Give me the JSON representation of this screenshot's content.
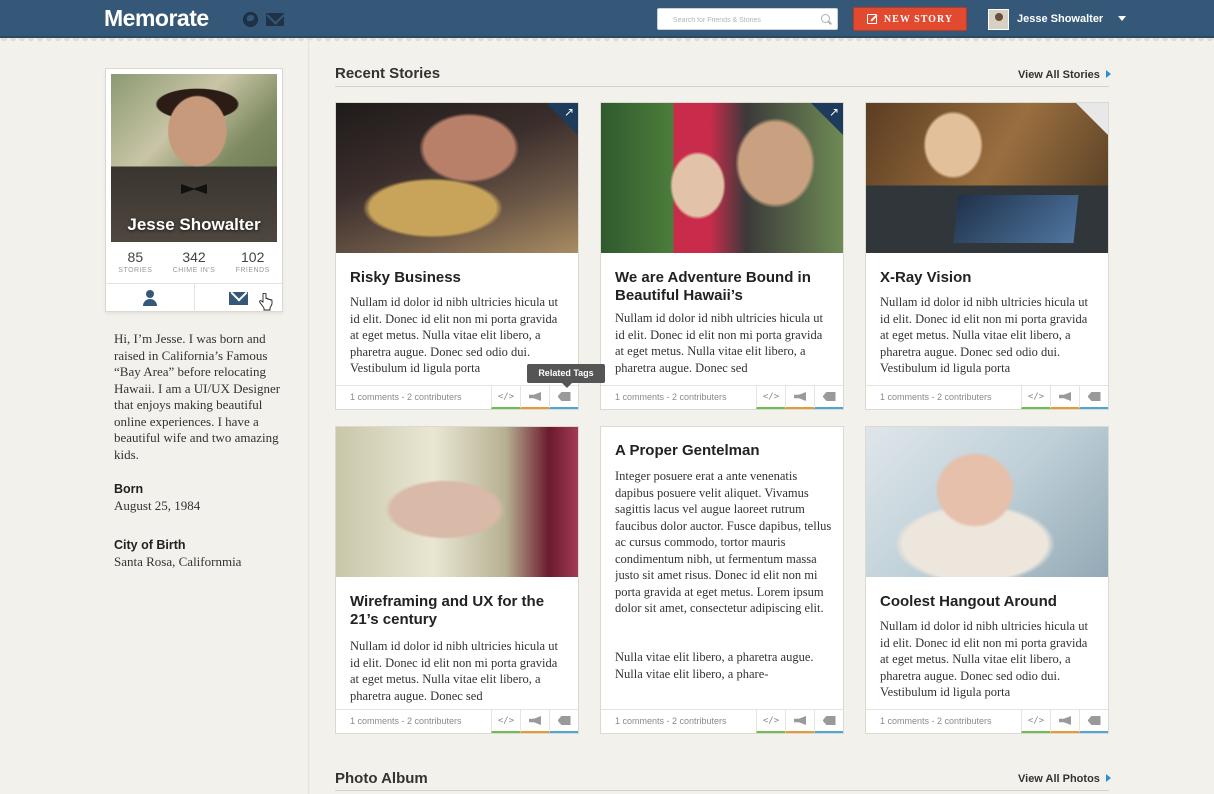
{
  "app": {
    "logo": "Memorate",
    "search_placeholder": "Search for Friends & Stories",
    "new_story_label": "NEW STORY",
    "user_name": "Jesse Showalter"
  },
  "profile": {
    "name": "Jesse Showalter",
    "stats": [
      {
        "num": "85",
        "label": "STORIES"
      },
      {
        "num": "342",
        "label": "CHIME IN'S"
      },
      {
        "num": "102",
        "label": "FRIENDS"
      }
    ],
    "bio": "Hi, I’m Jesse. I was born and raised in California’s Famous “Bay Area” before relocating Hawaii. I am a UI/UX Designer that enjoys making beautiful online experiences. I have a beautiful wife and two amazing kids.",
    "born_label": "Born",
    "born_value": "August 25, 1984",
    "city_label": "City of Birth",
    "city_value": "Santa Rosa, Californmia"
  },
  "recent": {
    "title": "Recent Stories",
    "view_all": "View All Stories"
  },
  "photos": {
    "title": "Photo Album",
    "view_all": "View All Photos"
  },
  "tooltip": "Related Tags",
  "cards": [
    {
      "title": "Risky Business",
      "excerpt": "Nullam id dolor id nibh ultricies hicula ut id elit. Donec id elit non mi porta gravida at eget metus. Nulla vitae elit libero, a pharetra augue. Donec sed odio dui. Vestibulum id ligula porta",
      "meta": "1 comments - 2 contributers"
    },
    {
      "title": "We are Adventure Bound in Beautiful Hawaii’s",
      "excerpt": "Nullam id dolor id nibh ultricies hicula ut id elit. Donec id elit non mi porta gravida at eget metus. Nulla vitae elit libero, a pharetra augue. Donec sed",
      "meta": "1 comments - 2 contributers"
    },
    {
      "title": "X-Ray Vision",
      "excerpt": "Nullam id dolor id nibh ultricies hicula ut id elit. Donec id elit non mi porta gravida at eget metus. Nulla vitae elit libero, a pharetra augue. Donec sed odio dui. Vestibulum id ligula porta",
      "meta": "1 comments - 2 contributers"
    },
    {
      "title": "Wireframing and UX for the 21’s century",
      "excerpt": "Nullam id dolor id nibh ultricies hicula ut id elit. Donec id elit non mi porta gravida at eget metus. Nulla vitae elit libero, a pharetra augue. Donec sed",
      "meta": "1 comments - 2 contributers"
    },
    {
      "title": "A Proper Gentelman",
      "excerpt": "Integer posuere erat a ante venenatis dapibus posuere velit aliquet. Vivamus sagittis lacus vel augue laoreet rutrum faucibus dolor auctor. Fusce dapibus, tellus ac cursus commodo, tortor mauris condimentum nibh, ut fermentum massa justo sit amet risus. Donec id elit non mi porta gravida at eget metus. Lorem ipsum dolor sit amet, consectetur adipiscing elit.",
      "excerpt2": "Nulla vitae elit libero, a pharetra augue. Nulla vitae elit libero, a phare-",
      "meta": "1 comments - 2 contributers"
    },
    {
      "title": "Coolest Hangout Around",
      "excerpt": "Nullam id dolor id nibh ultricies hicula ut id elit. Donec id elit non mi porta gravida at eget metus. Nulla vitae elit libero, a pharetra augue. Donec sed odio dui. Vestibulum id ligula porta",
      "meta": "1 comments - 2 contributers"
    }
  ],
  "footer_buttons": {
    "code": "</>"
  },
  "icons": {
    "share": "share-arrow-icon",
    "code": "code-icon",
    "megaphone": "megaphone-icon",
    "tag": "tag-icon"
  }
}
